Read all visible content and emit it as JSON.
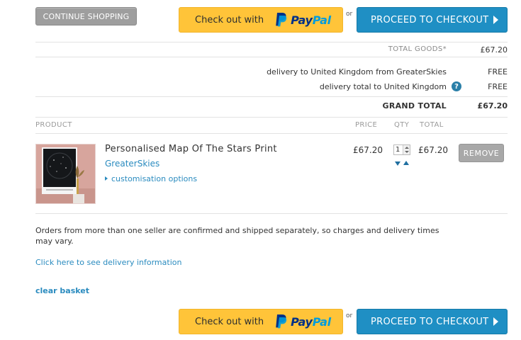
{
  "actions": {
    "continue_label": "CONTINUE SHOPPING",
    "paypal_prefix": "Check out with",
    "paypal_brand_1": "Pay",
    "paypal_brand_2": "Pal",
    "or_text": "or",
    "checkout_label": "PROCEED TO CHECKOUT"
  },
  "summary": {
    "total_goods_label": "TOTAL GOODS*",
    "total_goods_value": "£67.20",
    "delivery_from_label": "delivery to United Kingdom from GreaterSkies",
    "delivery_from_value": "FREE",
    "delivery_total_label": "delivery total to United Kingdom",
    "delivery_total_value": "FREE",
    "grand_total_label": "GRAND TOTAL",
    "grand_total_value": "£67.20"
  },
  "table": {
    "headers": [
      "PRODUCT",
      "PRICE",
      "QTY",
      "TOTAL"
    ]
  },
  "item": {
    "title": "Personalised Map Of The Stars Print",
    "seller": "GreaterSkies",
    "options_link": "customisation options",
    "price": "£67.20",
    "qty": "1",
    "total": "£67.20",
    "remove_label": "REMOVE"
  },
  "notes": {
    "shipping_note": "Orders from more than one seller are confirmed and shipped separately, so charges and delivery times may vary.",
    "delivery_link": "Click here to see delivery information",
    "clear_basket": "clear basket"
  },
  "colors": {
    "paypal_yellow": "#ffc439",
    "checkout_blue": "#1f8fc4",
    "link_blue": "#2a8bbf"
  }
}
